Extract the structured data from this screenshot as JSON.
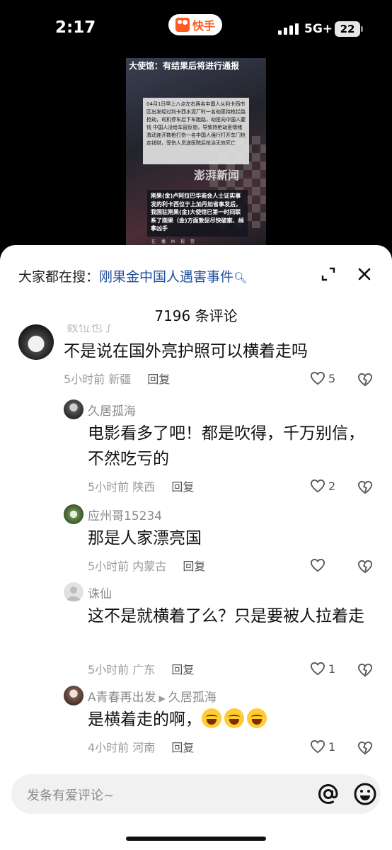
{
  "status_bar": {
    "time": "2:17",
    "app_name": "快手",
    "network": "5G+",
    "battery": "22"
  },
  "video": {
    "headline": "大使馆：有结果后将进行通报",
    "box1": "04月1日早上八点左右两名中国人从利卡西市区出发经过利卡西水泥厂时一名劫匪持枪拦路抢劫，司机停车后下车跑路，劫匪向中国人要钱 中国人没给车窗反锁，导致持枪劫匪情绪激动连开数枪打伤一名中国人强行打开车门抢走钱财，受伤人员送医院后抢治无效死亡",
    "watermark": "澎湃新闻",
    "box2": "刚果(金)卢阿拉巴华商会人士证实事发的利卡西位于上加丹加省事发后，我国驻刚果(金)大使馆已第一时间联系了刚果（金)方面敦促尽快破案、缉拿凶手",
    "footer": "在 播 M 视 觉"
  },
  "search_bar": {
    "prefix": "大家都在搜：",
    "query": "刚果金中国人遇害事件"
  },
  "comments_header": {
    "count_label": "7196 条评论"
  },
  "comments": [
    {
      "name": "数位也了",
      "text": "不是说在国外亮护照可以横着走吗",
      "time": "5小时前",
      "location": "新疆",
      "reply": "回复",
      "likes": "5"
    },
    {
      "name": "久居孤海",
      "text": "电影看多了吧！都是吹得，千万别信，不然吃亏的",
      "time": "5小时前",
      "location": "陕西",
      "reply": "回复",
      "likes": "2"
    },
    {
      "name": "应州哥15234",
      "text": "那是人家漂亮国",
      "time": "5小时前",
      "location": "内蒙古",
      "reply": "回复",
      "likes": ""
    },
    {
      "name": "诛仙",
      "text": "这不是就横着了么？只是要被人拉着走",
      "time": "5小时前",
      "location": "广东",
      "reply": "回复",
      "likes": "1"
    },
    {
      "name": "A青春再出发",
      "reply_to": "久居孤海",
      "text": "是横着走的啊，",
      "time": "4小时前",
      "location": "河南",
      "reply": "回复",
      "likes": "1"
    }
  ],
  "composer": {
    "placeholder": "发条有爱评论~"
  },
  "colors": {
    "accent": "#1e4e9c",
    "brand": "#ff5a1f"
  }
}
